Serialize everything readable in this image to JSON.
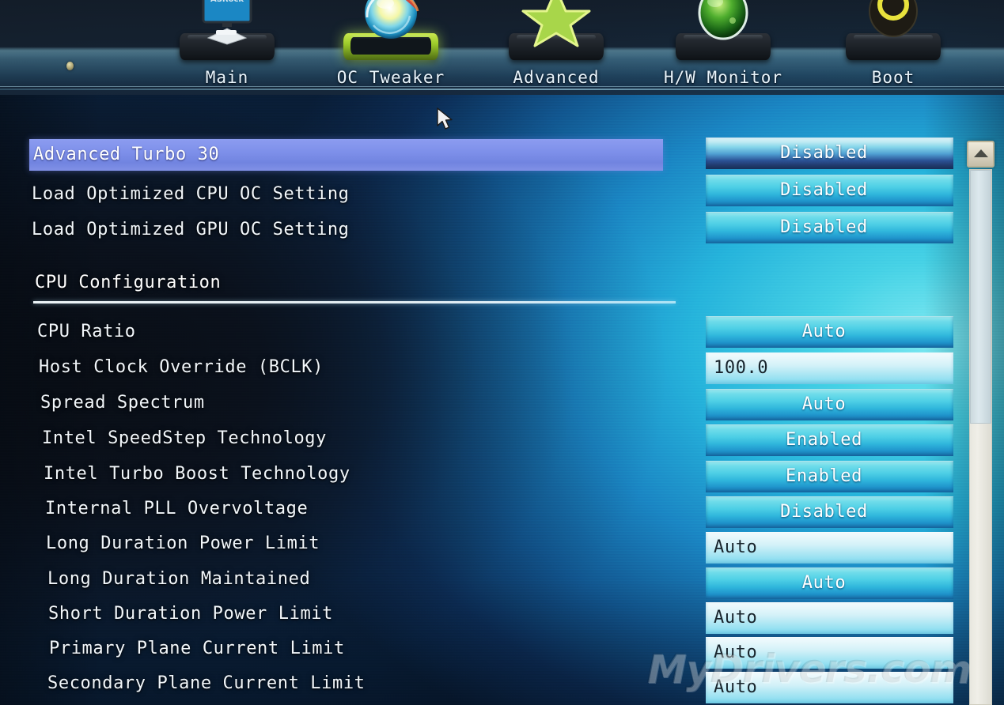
{
  "nav": {
    "tabs": [
      {
        "label": "Main",
        "icon": "monitor-icon",
        "active": false
      },
      {
        "label": "OC Tweaker",
        "icon": "tuning-orb-icon",
        "active": true
      },
      {
        "label": "Advanced",
        "icon": "star-icon",
        "active": false
      },
      {
        "label": "H/W Monitor",
        "icon": "gauge-orb-icon",
        "active": false
      },
      {
        "label": "Boot",
        "icon": "power-ring-icon",
        "active": false
      }
    ]
  },
  "menu": {
    "highlighted_item": "Advanced Turbo 30",
    "section_title": "CPU Configuration",
    "items": [
      {
        "label": "Advanced Turbo 30",
        "value": "Disabled",
        "control": "combo",
        "highlighted": true
      },
      {
        "label": "Load Optimized CPU OC Setting",
        "value": "Disabled",
        "control": "combo",
        "highlighted": false
      },
      {
        "label": "Load Optimized GPU OC Setting",
        "value": "Disabled",
        "control": "combo",
        "highlighted": false
      },
      {
        "label": "CPU Ratio",
        "value": "Auto",
        "control": "combo",
        "highlighted": false
      },
      {
        "label": "Host Clock Override (BCLK)",
        "value": "100.0",
        "control": "field",
        "highlighted": false
      },
      {
        "label": "Spread Spectrum",
        "value": "Auto",
        "control": "combo",
        "highlighted": false
      },
      {
        "label": "Intel SpeedStep Technology",
        "value": "Enabled",
        "control": "combo",
        "highlighted": false
      },
      {
        "label": "Intel Turbo Boost Technology",
        "value": "Enabled",
        "control": "combo",
        "highlighted": false
      },
      {
        "label": "Internal PLL Overvoltage",
        "value": "Disabled",
        "control": "combo",
        "highlighted": false
      },
      {
        "label": "Long Duration Power Limit",
        "value": "Auto",
        "control": "field",
        "highlighted": false
      },
      {
        "label": "Long Duration Maintained",
        "value": "Auto",
        "control": "combo",
        "highlighted": false
      },
      {
        "label": "Short Duration Power Limit",
        "value": "Auto",
        "control": "field",
        "highlighted": false
      },
      {
        "label": "Primary Plane Current Limit",
        "value": "Auto",
        "control": "field",
        "highlighted": false
      },
      {
        "label": "Secondary Plane Current Limit",
        "value": "Auto",
        "control": "field",
        "highlighted": false
      }
    ]
  },
  "scrollbar": {
    "up_arrow": "scroll-up-arrow-icon",
    "position": "top"
  },
  "cursor": {
    "icon": "mouse-pointer-icon"
  },
  "watermark": {
    "text": "MyDrivers.com"
  },
  "colors": {
    "highlight_row": "#7e90ea",
    "accent_cyan": "#2fb6dc",
    "active_tab_pedestal": "#9ccb2a",
    "text_light": "#f2f7fb",
    "field_text": "#18242c"
  }
}
